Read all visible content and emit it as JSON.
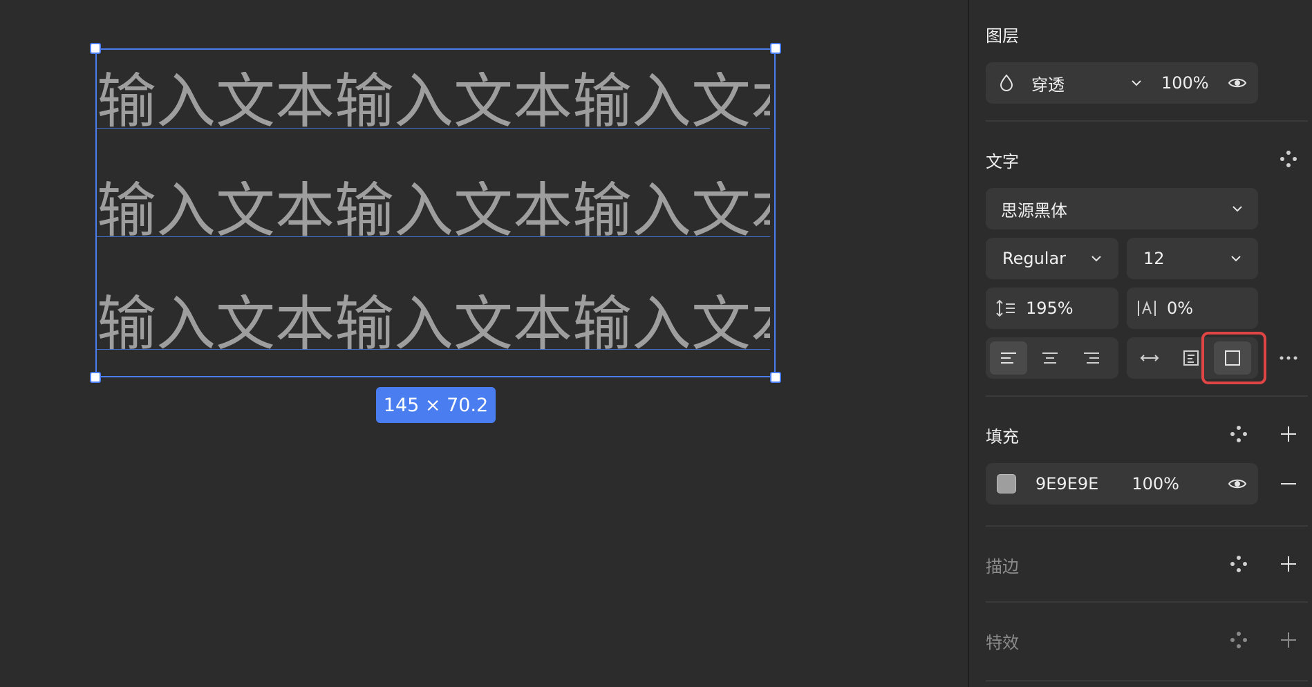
{
  "canvas": {
    "text_lines": [
      "输入文本输入文本输入文本",
      "输入文本输入文本输入文本",
      "输入文本输入文本输入文本"
    ],
    "size_badge": "145 × 70.2",
    "text_color": "#9e9e9e",
    "selection_color": "#4a7df0"
  },
  "panel": {
    "layer": {
      "title": "图层",
      "blend_mode": "穿透",
      "opacity": "100%",
      "icons": [
        "droplet-icon",
        "chevron-down-icon",
        "eye-icon"
      ]
    },
    "text": {
      "title": "文字",
      "font_family": "思源黑体",
      "font_weight": "Regular",
      "font_size": "12",
      "line_height": "195%",
      "letter_spacing": "0%",
      "icons": [
        "style-dots-icon",
        "line-height-icon",
        "letter-spacing-icon",
        "align-left-icon",
        "align-center-icon",
        "align-right-icon",
        "auto-width-icon",
        "auto-height-icon",
        "fixed-size-icon",
        "more-icon"
      ]
    },
    "fill": {
      "title": "填充",
      "hex": "9E9E9E",
      "opacity": "100%",
      "swatch_color": "#9e9e9e",
      "icons": [
        "style-dots-icon",
        "plus-icon",
        "eye-icon",
        "minus-icon"
      ]
    },
    "stroke": {
      "title": "描边",
      "icons": [
        "style-dots-icon",
        "plus-icon"
      ]
    },
    "effects": {
      "title": "特效",
      "icons": [
        "style-dots-icon",
        "plus-icon"
      ]
    }
  }
}
